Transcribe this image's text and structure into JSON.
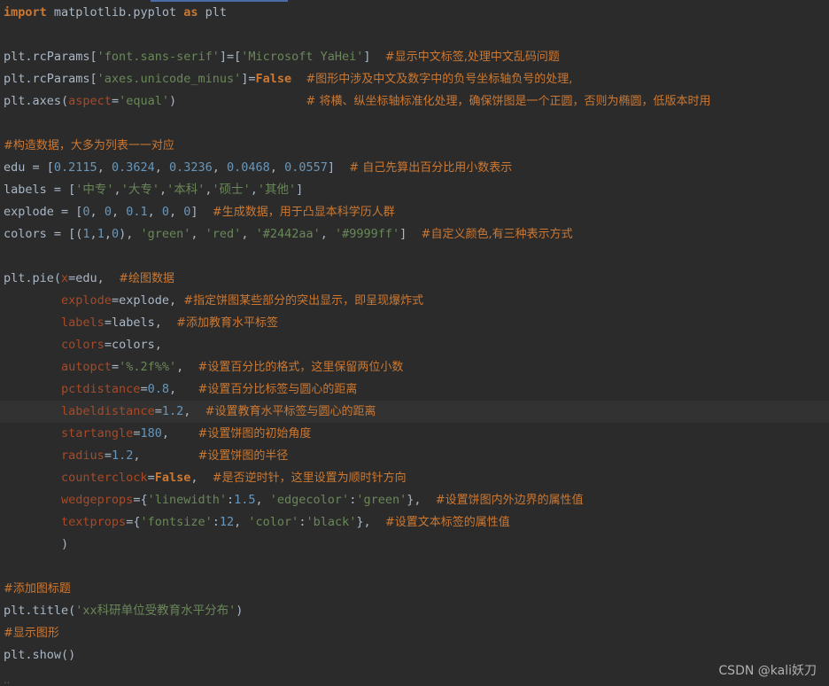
{
  "editor": {
    "lines": [
      [
        {
          "c": "kw",
          "t": "import"
        },
        {
          "c": "plain",
          "t": " matplotlib.pyplot "
        },
        {
          "c": "kw",
          "t": "as"
        },
        {
          "c": "plain",
          "t": " plt"
        }
      ],
      [],
      [
        {
          "c": "plain",
          "t": "plt.rcParams["
        },
        {
          "c": "str",
          "t": "'font.sans-serif'"
        },
        {
          "c": "plain",
          "t": "]=["
        },
        {
          "c": "str",
          "t": "'Microsoft YaHei'"
        },
        {
          "c": "plain",
          "t": "]  "
        },
        {
          "c": "cmt-cn",
          "t": "#显示中文标签,处理中文乱码问题"
        }
      ],
      [
        {
          "c": "plain",
          "t": "plt.rcParams["
        },
        {
          "c": "str",
          "t": "'axes.unicode_minus'"
        },
        {
          "c": "plain",
          "t": "]="
        },
        {
          "c": "const",
          "t": "False"
        },
        {
          "c": "plain",
          "t": "  "
        },
        {
          "c": "cmt-cn",
          "t": "#图形中涉及中文及数字中的负号坐标轴负号的处理,"
        }
      ],
      [
        {
          "c": "plain",
          "t": "plt.axes("
        },
        {
          "c": "param",
          "t": "aspect"
        },
        {
          "c": "plain",
          "t": "="
        },
        {
          "c": "str",
          "t": "'equal'"
        },
        {
          "c": "plain",
          "t": ")                  "
        },
        {
          "c": "cmt-cn",
          "t": "# 将横、纵坐标轴标准化处理，确保饼图是一个正圆，否则为椭圆，低版本时用"
        }
      ],
      [],
      [
        {
          "c": "cmt-cn",
          "t": "#构造数据，大多为列表一一对应"
        }
      ],
      [
        {
          "c": "plain",
          "t": "edu = ["
        },
        {
          "c": "num",
          "t": "0.2115"
        },
        {
          "c": "plain",
          "t": ", "
        },
        {
          "c": "num",
          "t": "0.3624"
        },
        {
          "c": "plain",
          "t": ", "
        },
        {
          "c": "num",
          "t": "0.3236"
        },
        {
          "c": "plain",
          "t": ", "
        },
        {
          "c": "num",
          "t": "0.0468"
        },
        {
          "c": "plain",
          "t": ", "
        },
        {
          "c": "num",
          "t": "0.0557"
        },
        {
          "c": "plain",
          "t": "]  "
        },
        {
          "c": "cmt-cn",
          "t": "# 自己先算出百分比用小数表示"
        }
      ],
      [
        {
          "c": "plain",
          "t": "labels = ["
        },
        {
          "c": "str",
          "t": "'中专'"
        },
        {
          "c": "plain",
          "t": ","
        },
        {
          "c": "str",
          "t": "'大专'"
        },
        {
          "c": "plain",
          "t": ","
        },
        {
          "c": "str",
          "t": "'本科'"
        },
        {
          "c": "plain",
          "t": ","
        },
        {
          "c": "str",
          "t": "'硕士'"
        },
        {
          "c": "plain",
          "t": ","
        },
        {
          "c": "str",
          "t": "'其他'"
        },
        {
          "c": "plain",
          "t": "]"
        }
      ],
      [
        {
          "c": "plain",
          "t": "explode = ["
        },
        {
          "c": "num",
          "t": "0"
        },
        {
          "c": "plain",
          "t": ", "
        },
        {
          "c": "num",
          "t": "0"
        },
        {
          "c": "plain",
          "t": ", "
        },
        {
          "c": "num",
          "t": "0.1"
        },
        {
          "c": "plain",
          "t": ", "
        },
        {
          "c": "num",
          "t": "0"
        },
        {
          "c": "plain",
          "t": ", "
        },
        {
          "c": "num",
          "t": "0"
        },
        {
          "c": "plain",
          "t": "]  "
        },
        {
          "c": "cmt-cn",
          "t": "#生成数据，用于凸显本科学历人群"
        }
      ],
      [
        {
          "c": "plain",
          "t": "colors = [("
        },
        {
          "c": "num",
          "t": "1"
        },
        {
          "c": "plain",
          "t": ","
        },
        {
          "c": "num",
          "t": "1"
        },
        {
          "c": "plain",
          "t": ","
        },
        {
          "c": "num",
          "t": "0"
        },
        {
          "c": "plain",
          "t": "), "
        },
        {
          "c": "str",
          "t": "'green'"
        },
        {
          "c": "plain",
          "t": ", "
        },
        {
          "c": "str",
          "t": "'red'"
        },
        {
          "c": "plain",
          "t": ", "
        },
        {
          "c": "str",
          "t": "'#2442aa'"
        },
        {
          "c": "plain",
          "t": ", "
        },
        {
          "c": "str",
          "t": "'#9999ff'"
        },
        {
          "c": "plain",
          "t": "]  "
        },
        {
          "c": "cmt-cn",
          "t": "#自定义颜色,有三种表示方式"
        }
      ],
      [],
      [
        {
          "c": "plain",
          "t": "plt.pie("
        },
        {
          "c": "param",
          "t": "x"
        },
        {
          "c": "plain",
          "t": "=edu,  "
        },
        {
          "c": "cmt-cn",
          "t": "#绘图数据"
        }
      ],
      [
        {
          "c": "plain",
          "t": "        "
        },
        {
          "c": "param",
          "t": "explode"
        },
        {
          "c": "plain",
          "t": "=explode, "
        },
        {
          "c": "cmt-cn",
          "t": "#指定饼图某些部分的突出显示，即呈现爆炸式"
        }
      ],
      [
        {
          "c": "plain",
          "t": "        "
        },
        {
          "c": "param",
          "t": "labels"
        },
        {
          "c": "plain",
          "t": "=labels,  "
        },
        {
          "c": "cmt-cn",
          "t": "#添加教育水平标签"
        }
      ],
      [
        {
          "c": "plain",
          "t": "        "
        },
        {
          "c": "param",
          "t": "colors"
        },
        {
          "c": "plain",
          "t": "=colors,"
        }
      ],
      [
        {
          "c": "plain",
          "t": "        "
        },
        {
          "c": "param",
          "t": "autopct"
        },
        {
          "c": "plain",
          "t": "="
        },
        {
          "c": "str",
          "t": "'%.2f%%'"
        },
        {
          "c": "plain",
          "t": ",  "
        },
        {
          "c": "cmt-cn",
          "t": "#设置百分比的格式，这里保留两位小数"
        }
      ],
      [
        {
          "c": "plain",
          "t": "        "
        },
        {
          "c": "param",
          "t": "pctdistance"
        },
        {
          "c": "plain",
          "t": "="
        },
        {
          "c": "num",
          "t": "0.8"
        },
        {
          "c": "plain",
          "t": ",   "
        },
        {
          "c": "cmt-cn",
          "t": "#设置百分比标签与圆心的距离"
        }
      ],
      [
        {
          "c": "plain",
          "t": "        "
        },
        {
          "c": "param",
          "t": "labeldistance"
        },
        {
          "c": "plain",
          "t": "="
        },
        {
          "c": "num",
          "t": "1.2"
        },
        {
          "c": "plain",
          "t": ",  "
        },
        {
          "c": "cmt-cn",
          "t": "#设置教育水平标签与圆心的距离"
        }
      ],
      [
        {
          "c": "plain",
          "t": "        "
        },
        {
          "c": "param",
          "t": "startangle"
        },
        {
          "c": "plain",
          "t": "="
        },
        {
          "c": "num",
          "t": "180"
        },
        {
          "c": "plain",
          "t": ",    "
        },
        {
          "c": "cmt-cn",
          "t": "#设置饼图的初始角度"
        }
      ],
      [
        {
          "c": "plain",
          "t": "        "
        },
        {
          "c": "param",
          "t": "radius"
        },
        {
          "c": "plain",
          "t": "="
        },
        {
          "c": "num",
          "t": "1.2"
        },
        {
          "c": "plain",
          "t": ",        "
        },
        {
          "c": "cmt-cn",
          "t": "#设置饼图的半径"
        }
      ],
      [
        {
          "c": "plain",
          "t": "        "
        },
        {
          "c": "param",
          "t": "counterclock"
        },
        {
          "c": "plain",
          "t": "="
        },
        {
          "c": "const",
          "t": "False"
        },
        {
          "c": "plain",
          "t": ",  "
        },
        {
          "c": "cmt-cn",
          "t": "#是否逆时针，这里设置为顺时针方向"
        }
      ],
      [
        {
          "c": "plain",
          "t": "        "
        },
        {
          "c": "param",
          "t": "wedgeprops"
        },
        {
          "c": "plain",
          "t": "={"
        },
        {
          "c": "str",
          "t": "'linewidth'"
        },
        {
          "c": "plain",
          "t": ":"
        },
        {
          "c": "num",
          "t": "1.5"
        },
        {
          "c": "plain",
          "t": ", "
        },
        {
          "c": "str",
          "t": "'edgecolor'"
        },
        {
          "c": "plain",
          "t": ":"
        },
        {
          "c": "str",
          "t": "'green'"
        },
        {
          "c": "plain",
          "t": "},  "
        },
        {
          "c": "cmt-cn",
          "t": "#设置饼图内外边界的属性值"
        }
      ],
      [
        {
          "c": "plain",
          "t": "        "
        },
        {
          "c": "param",
          "t": "textprops"
        },
        {
          "c": "plain",
          "t": "={"
        },
        {
          "c": "str",
          "t": "'fontsize'"
        },
        {
          "c": "plain",
          "t": ":"
        },
        {
          "c": "num",
          "t": "12"
        },
        {
          "c": "plain",
          "t": ", "
        },
        {
          "c": "str",
          "t": "'color'"
        },
        {
          "c": "plain",
          "t": ":"
        },
        {
          "c": "str",
          "t": "'black'"
        },
        {
          "c": "plain",
          "t": "},  "
        },
        {
          "c": "cmt-cn",
          "t": "#设置文本标签的属性值"
        }
      ],
      [
        {
          "c": "plain",
          "t": "        )"
        }
      ],
      [],
      [
        {
          "c": "cmt-cn",
          "t": "#添加图标题"
        }
      ],
      [
        {
          "c": "plain",
          "t": "plt.title("
        },
        {
          "c": "str",
          "t": "'xx科研单位受教育水平分布'"
        },
        {
          "c": "plain",
          "t": ")"
        }
      ],
      [
        {
          "c": "cmt-cn",
          "t": "#显示图形"
        }
      ],
      [
        {
          "c": "plain",
          "t": "plt.show()"
        }
      ]
    ],
    "current_line": 18
  },
  "colors": {
    "background": "#2b2b2b",
    "current_line": "#323232",
    "keyword": "#cc7832",
    "string": "#6a8759",
    "number": "#6897bb",
    "parameter": "#aa4926",
    "text": "#a9b7c6"
  },
  "watermark": {
    "text": "CSDN @kali妖刀"
  }
}
